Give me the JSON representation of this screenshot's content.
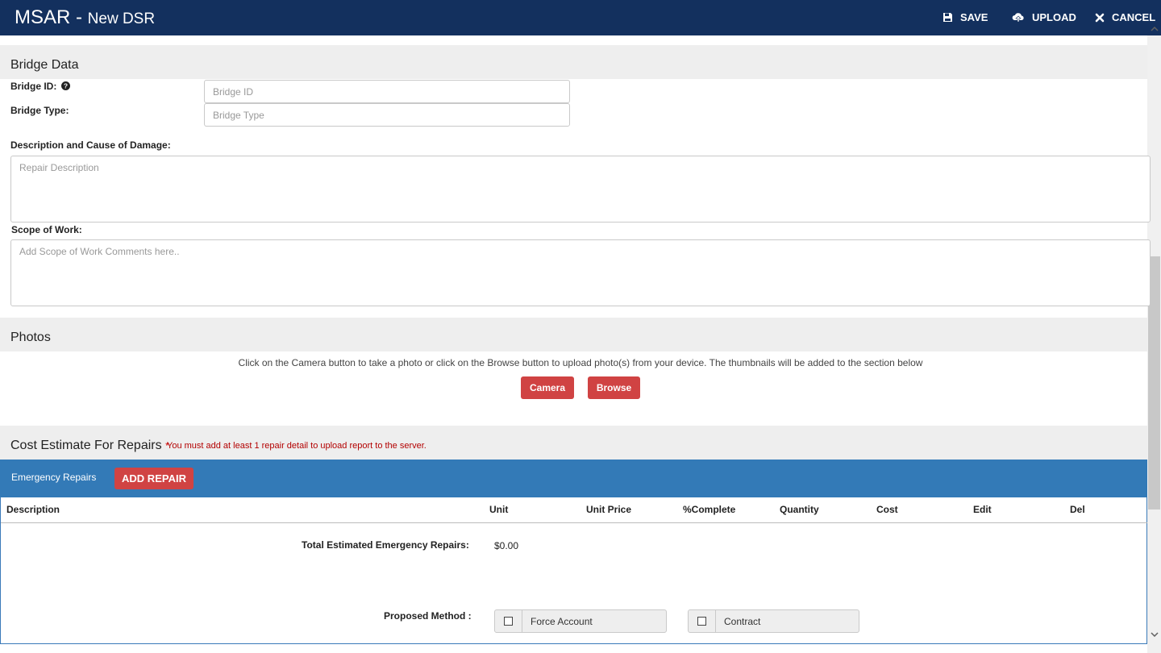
{
  "header": {
    "app_name": "MSAR -",
    "page_name": "New DSR",
    "actions": [
      {
        "label": "SAVE",
        "icon": "save-icon"
      },
      {
        "label": "UPLOAD",
        "icon": "upload-icon"
      },
      {
        "label": "CANCEL",
        "icon": "close-icon"
      }
    ]
  },
  "bridge_data": {
    "section_title": "Bridge Data",
    "bridge_id_label": "Bridge ID:",
    "bridge_id_placeholder": "Bridge ID",
    "bridge_type_label": "Bridge Type:",
    "bridge_type_placeholder": "Bridge Type",
    "damage_label": "Description and Cause of Damage:",
    "damage_placeholder": "Repair Description",
    "scope_label": "Scope of Work:",
    "scope_placeholder": "Add Scope of Work Comments here.."
  },
  "photos": {
    "section_title": "Photos",
    "hint": "Click on the Camera button to take a photo or click on the Browse button to upload photo(s) from your device. The thumbnails will be added to the section below",
    "camera_label": "Camera",
    "browse_label": "Browse"
  },
  "cost_estimate": {
    "section_title": "Cost Estimate For Repairs",
    "required_marker": "*",
    "required_message": "You must add at least 1 repair detail to upload report to the server.",
    "panel_title": "Emergency Repairs",
    "add_repair_label": "ADD REPAIR",
    "columns": [
      "Description",
      "Unit",
      "Unit Price",
      "%Complete",
      "Quantity",
      "Cost",
      "Edit",
      "Del"
    ],
    "total_label": "Total Estimated Emergency Repairs:",
    "total_value": "$0.00",
    "proposed_method_label": "Proposed Method :",
    "methods": [
      "Force Account",
      "Contract"
    ]
  },
  "colors": {
    "header_bg": "#13305e",
    "panel_bar": "#337ab7",
    "button_red": "#d04343",
    "required_red": "#b30000"
  }
}
